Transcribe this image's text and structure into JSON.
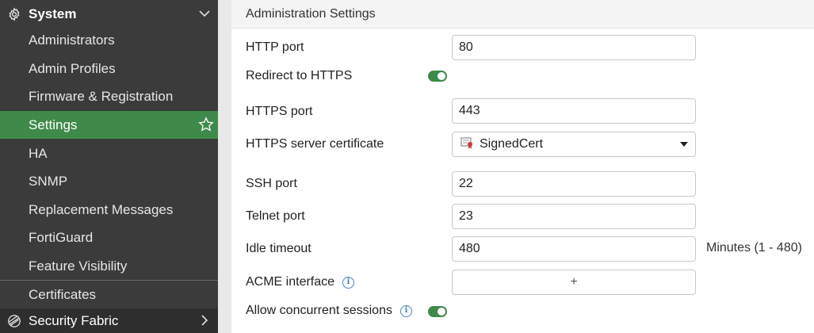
{
  "sidebar": {
    "system_label": "System",
    "items": [
      {
        "label": "Administrators"
      },
      {
        "label": "Admin Profiles"
      },
      {
        "label": "Firmware & Registration"
      },
      {
        "label": "Settings"
      },
      {
        "label": "HA"
      },
      {
        "label": "SNMP"
      },
      {
        "label": "Replacement Messages"
      },
      {
        "label": "FortiGuard"
      },
      {
        "label": "Feature Visibility"
      },
      {
        "label": "Certificates"
      }
    ],
    "security_fabric_label": "Security Fabric",
    "active_item": "Settings"
  },
  "section": {
    "title": "Administration Settings"
  },
  "form": {
    "http_port": {
      "label": "HTTP port",
      "value": "80"
    },
    "redirect_https": {
      "label": "Redirect to HTTPS",
      "enabled": true
    },
    "https_port": {
      "label": "HTTPS port",
      "value": "443"
    },
    "https_cert": {
      "label": "HTTPS server certificate",
      "value": "SignedCert"
    },
    "ssh_port": {
      "label": "SSH port",
      "value": "22"
    },
    "telnet_port": {
      "label": "Telnet port",
      "value": "23"
    },
    "idle_timeout": {
      "label": "Idle timeout",
      "value": "480",
      "suffix": "Minutes (1 - 480)"
    },
    "acme_interface": {
      "label": "ACME interface",
      "add_label": "+"
    },
    "concurrent_sessions": {
      "label": "Allow concurrent sessions",
      "enabled": true
    }
  },
  "colors": {
    "sidebar_bg": "#3b3b3b",
    "active_green": "#3f8a4a",
    "toggle_green": "#3f8a4a",
    "info_blue": "#4a7fc1"
  }
}
